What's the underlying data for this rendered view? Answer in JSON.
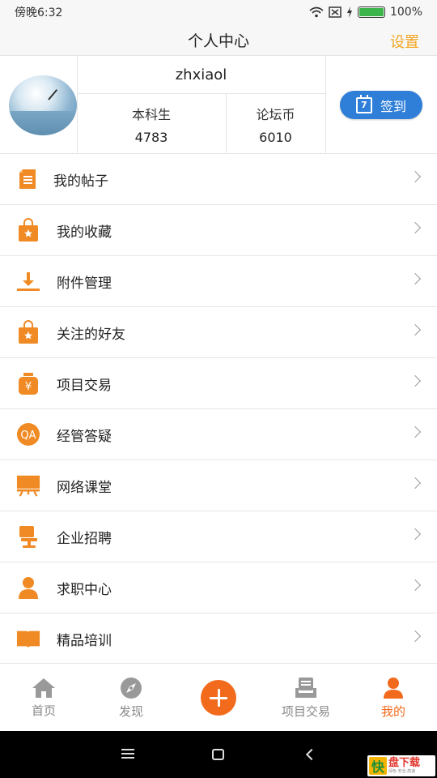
{
  "status_bar": {
    "time": "傍晚6:32",
    "battery": "100%"
  },
  "header": {
    "title": "个人中心",
    "settings_label": "设置"
  },
  "profile": {
    "username": "zhxiaol",
    "stats": [
      {
        "label": "本科生",
        "value": "4783"
      },
      {
        "label": "论坛币",
        "value": "6010"
      }
    ],
    "signin_label": "签到",
    "calendar_day": "7"
  },
  "menu": [
    {
      "label": "我的帖子",
      "icon": "document-icon"
    },
    {
      "label": "我的收藏",
      "icon": "shopping-bag-star-icon"
    },
    {
      "label": "附件管理",
      "icon": "download-icon"
    },
    {
      "label": "关注的好友",
      "icon": "shopping-bag-star-icon"
    },
    {
      "label": "项目交易",
      "icon": "money-bag-icon"
    },
    {
      "label": "经管答疑",
      "icon": "qa-icon"
    },
    {
      "label": "网络课堂",
      "icon": "presentation-board-icon"
    },
    {
      "label": "企业招聘",
      "icon": "office-chair-icon"
    },
    {
      "label": "求职中心",
      "icon": "user-icon"
    },
    {
      "label": "精品培训",
      "icon": "open-book-icon"
    }
  ],
  "tabbar": [
    {
      "label": "首页",
      "icon": "home-icon"
    },
    {
      "label": "发现",
      "icon": "compass-icon"
    },
    {
      "label": "",
      "icon": "add-icon"
    },
    {
      "label": "项目交易",
      "icon": "stack-icon"
    },
    {
      "label": "我的",
      "icon": "user-icon",
      "active": true
    }
  ],
  "watermark": {
    "brand": "快",
    "text": "盘下载",
    "sub": "绿色·安全·高速"
  },
  "colors": {
    "accent": "#f26b1d",
    "icon_orange": "#f08a24",
    "settings": "#f5a623",
    "signin_blue": "#2f7fd9"
  }
}
